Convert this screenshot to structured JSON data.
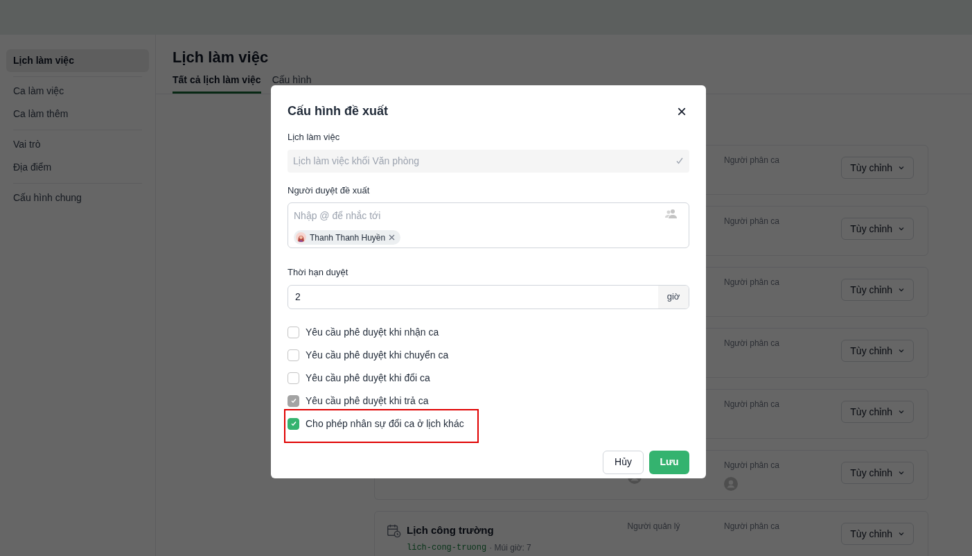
{
  "sidebar": {
    "groups": [
      [
        {
          "label": "Lịch làm việc",
          "selected": true
        }
      ],
      [
        {
          "label": "Ca làm việc",
          "selected": false
        },
        {
          "label": "Ca làm thêm",
          "selected": false
        }
      ],
      [
        {
          "label": "Vai trò",
          "selected": false
        },
        {
          "label": "Địa điểm",
          "selected": false
        }
      ],
      [
        {
          "label": "Cấu hình chung",
          "selected": false
        }
      ]
    ]
  },
  "page": {
    "title": "Lịch làm việc",
    "tabs": [
      {
        "label": "Tất cả lịch làm việc",
        "selected": true
      },
      {
        "label": "Cấu hình",
        "selected": false
      }
    ]
  },
  "schedules": [
    {
      "assigner_label": "Người phân ca",
      "button": "Tùy chỉnh"
    },
    {
      "assigner_label": "Người phân ca",
      "button": "Tùy chỉnh"
    },
    {
      "assigner_label": "Người phân ca",
      "button": "Tùy chỉnh"
    },
    {
      "assigner_label": "Người phân ca",
      "button": "Tùy chỉnh"
    },
    {
      "assigner_label": "Người phân ca",
      "button": "Tùy chỉnh"
    },
    {
      "assigner_label": "Người phân ca",
      "button": "Tùy chỉnh",
      "manager_avatar": true,
      "assigner_avatar": true
    },
    {
      "title": "Lịch công trường",
      "slug": "lich-cong-truong",
      "timezone": "· Múi giờ: 7",
      "manager_label": "Người quản lý",
      "assigner_label": "Người phân ca",
      "button": "Tùy chỉnh"
    }
  ],
  "dialog": {
    "title": "Cấu hình đề xuất",
    "close": "×",
    "schedule": {
      "label": "Lịch làm việc",
      "value": "Lịch làm việc khối Văn phòng",
      "disabled": true
    },
    "approvers": {
      "label": "Người duyệt đề xuất",
      "placeholder": "Nhập @ để nhắc tới",
      "chips": [
        {
          "name": "Thanh Thanh Huyền"
        }
      ]
    },
    "deadline": {
      "label": "Thời hạn duyệt",
      "value": "2",
      "unit": "giờ"
    },
    "options": [
      {
        "label": "Yêu cầu phê duyệt khi nhận ca",
        "checked": false,
        "disabled": false,
        "highlighted": false
      },
      {
        "label": "Yêu cầu phê duyệt khi chuyển ca",
        "checked": false,
        "disabled": false,
        "highlighted": false
      },
      {
        "label": "Yêu cầu phê duyệt khi đổi ca",
        "checked": false,
        "disabled": false,
        "highlighted": false
      },
      {
        "label": "Yêu cầu phê duyệt khi trả ca",
        "checked": true,
        "disabled": true,
        "highlighted": false
      },
      {
        "label": "Cho phép nhân sự đổi ca ở lịch khác",
        "checked": true,
        "disabled": false,
        "highlighted": true
      }
    ],
    "cancel": "Hủy",
    "save": "Lưu"
  }
}
